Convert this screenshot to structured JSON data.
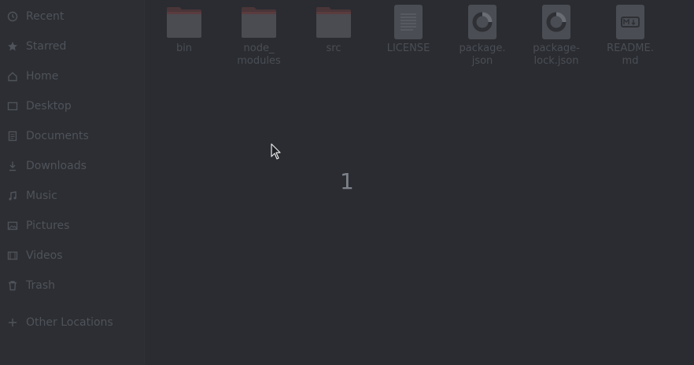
{
  "sidebar": {
    "items": [
      {
        "label": "Recent",
        "icon": "clock-icon"
      },
      {
        "label": "Starred",
        "icon": "star-icon"
      },
      {
        "label": "Home",
        "icon": "home-icon"
      },
      {
        "label": "Desktop",
        "icon": "desktop-icon"
      },
      {
        "label": "Documents",
        "icon": "document-icon"
      },
      {
        "label": "Downloads",
        "icon": "download-icon"
      },
      {
        "label": "Music",
        "icon": "music-icon"
      },
      {
        "label": "Pictures",
        "icon": "picture-icon"
      },
      {
        "label": "Videos",
        "icon": "video-icon"
      },
      {
        "label": "Trash",
        "icon": "trash-icon"
      },
      {
        "label": "Other Locations",
        "icon": "plus-icon"
      }
    ]
  },
  "files": [
    {
      "name": "bin",
      "type": "folder"
    },
    {
      "name": "node_\nmodules",
      "type": "folder"
    },
    {
      "name": "src",
      "type": "folder"
    },
    {
      "name": "LICENSE",
      "type": "text"
    },
    {
      "name": "package.\njson",
      "type": "json"
    },
    {
      "name": "package-\nlock.json",
      "type": "json"
    },
    {
      "name": "README.\nmd",
      "type": "markdown"
    }
  ],
  "overlay": {
    "counter": "1"
  },
  "colors": {
    "background": "#2a2c31",
    "folder": "#5a3c3f",
    "file": "#4a4d53",
    "text_dim": "#4f535a"
  }
}
